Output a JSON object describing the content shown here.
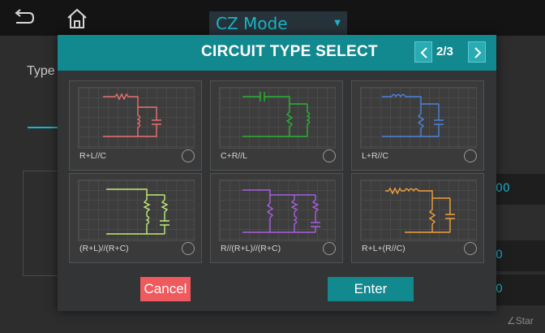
{
  "topbar": {
    "mode_value": "CZ Mode",
    "icons": {
      "back": "back-arrow-icon",
      "home": "home-icon",
      "caret": "caret-down-icon"
    }
  },
  "background": {
    "type_label": "Type",
    "field_a_value": "00",
    "field_b_value": "0",
    "field_c_value": "0",
    "start_label": "∠Star"
  },
  "dialog": {
    "title": "CIRCUIT TYPE SELECT",
    "page_label": "2/3",
    "icons": {
      "prev": "chevron-left-icon",
      "next": "chevron-right-icon"
    },
    "circuits": [
      {
        "label": "R+L//C",
        "color": "#e8706f",
        "selected": false
      },
      {
        "label": "C+R//L",
        "color": "#27b431",
        "selected": false
      },
      {
        "label": "L+R//C",
        "color": "#4c82dd",
        "selected": false
      },
      {
        "label": "(R+L)//(R+C)",
        "color": "#c0ec79",
        "selected": false
      },
      {
        "label": "R//(R+L)//(R+C)",
        "color": "#a85fe0",
        "selected": false
      },
      {
        "label": "R+L+(R//C)",
        "color": "#f0a03a",
        "selected": false
      }
    ],
    "cancel_label": "Cancel",
    "enter_label": "Enter",
    "colors": {
      "header": "#12888f",
      "cancel": "#ee5a5e",
      "enter": "#12888f"
    }
  }
}
